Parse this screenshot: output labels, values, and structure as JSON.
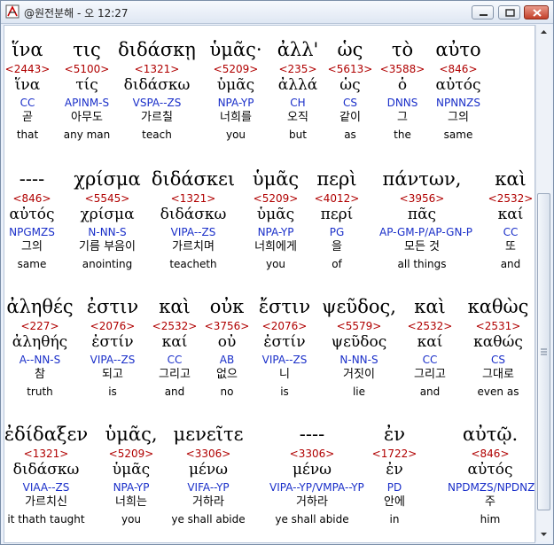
{
  "window": {
    "title": "@원전분해 - 오 12:27",
    "buttons": {
      "minimize": "minimize",
      "maximize": "maximize",
      "close": "close"
    },
    "icon": "app-bible-icon"
  },
  "colors": {
    "strong": "#b00000",
    "parse": "#1a2fc9"
  },
  "rows": [
    {
      "words": [
        {
          "greek": "ἵνα",
          "strong": "<2443>",
          "lemma": "ἵνα",
          "parse": "CC",
          "korean": "곧",
          "english": "that"
        },
        {
          "greek": "τις",
          "strong": "<5100>",
          "lemma": "τίς",
          "parse": "APINM-S",
          "korean": "아무도",
          "english": "any man"
        },
        {
          "greek": "διδάσκῃ",
          "strong": "<1321>",
          "lemma": "διδάσκω",
          "parse": "VSPA--ZS",
          "korean": "가르칠",
          "english": "teach"
        },
        {
          "greek": "ὑμᾶς·",
          "strong": "<5209>",
          "lemma": "ὑμᾶς",
          "parse": "NPA-YP",
          "korean": "너희를",
          "english": "you"
        },
        {
          "greek": "ἀλλ'",
          "strong": "<235>",
          "lemma": "ἀλλά",
          "parse": "CH",
          "korean": "오직",
          "english": "but"
        },
        {
          "greek": "ὡς",
          "strong": "<5613>",
          "lemma": "ὡς",
          "parse": "CS",
          "korean": "같이",
          "english": "as"
        },
        {
          "greek": "τὸ",
          "strong": "<3588>",
          "lemma": "ὁ",
          "parse": "DNNS",
          "korean": "그",
          "english": "the"
        },
        {
          "greek": "αὐτο",
          "strong": "<846>",
          "lemma": "αὐτός",
          "parse": "NPNNZS",
          "korean": "그의",
          "english": "same"
        }
      ]
    },
    {
      "words": [
        {
          "greek": "----",
          "strong": "<846>",
          "lemma": "αὐτός",
          "parse": "NPGMZS",
          "korean": "그의",
          "english": "same"
        },
        {
          "greek": "χρίσμα",
          "strong": "<5545>",
          "lemma": "χρίσμα",
          "parse": "N-NN-S",
          "korean": "기름 부음이",
          "english": "anointing"
        },
        {
          "greek": "διδάσκει",
          "strong": "<1321>",
          "lemma": "διδάσκω",
          "parse": "VIPA--ZS",
          "korean": "가르치며",
          "english": "teacheth"
        },
        {
          "greek": "ὑμᾶς",
          "strong": "<5209>",
          "lemma": "ὑμᾶς",
          "parse": "NPA-YP",
          "korean": "너희에게",
          "english": "you"
        },
        {
          "greek": "περὶ",
          "strong": "<4012>",
          "lemma": "περί",
          "parse": "PG",
          "korean": "을",
          "english": "of"
        },
        {
          "greek": "πάντων,",
          "strong": "<3956>",
          "lemma": "πᾶς",
          "parse": "AP-GM-P/AP-GN-P",
          "korean": "모든 것",
          "english": "all things"
        },
        {
          "greek": "καὶ",
          "strong": "<2532>",
          "lemma": "καί",
          "parse": "CC",
          "korean": "또",
          "english": "and"
        }
      ]
    },
    {
      "words": [
        {
          "greek": "ἀληθές",
          "strong": "<227>",
          "lemma": "ἀληθής",
          "parse": "A--NN-S",
          "korean": "참",
          "english": "truth"
        },
        {
          "greek": "ἐστιν",
          "strong": "<2076>",
          "lemma": "ἐστίν",
          "parse": "VIPA--ZS",
          "korean": "되고",
          "english": "is"
        },
        {
          "greek": "καὶ",
          "strong": "<2532>",
          "lemma": "καί",
          "parse": "CC",
          "korean": "그리고",
          "english": "and"
        },
        {
          "greek": "οὐκ",
          "strong": "<3756>",
          "lemma": "οὐ",
          "parse": "AB",
          "korean": "없으",
          "english": "no"
        },
        {
          "greek": "ἔστιν",
          "strong": "<2076>",
          "lemma": "ἐστίν",
          "parse": "VIPA--ZS",
          "korean": "니",
          "english": "is"
        },
        {
          "greek": "ψεῦδος,",
          "strong": "<5579>",
          "lemma": "ψεῦδος",
          "parse": "N-NN-S",
          "korean": "거짓이",
          "english": "lie"
        },
        {
          "greek": "καὶ",
          "strong": "<2532>",
          "lemma": "καί",
          "parse": "CC",
          "korean": "그리고",
          "english": "and"
        },
        {
          "greek": "καθὼς",
          "strong": "<2531>",
          "lemma": "καθώς",
          "parse": "CS",
          "korean": "그대로",
          "english": "even as"
        }
      ]
    },
    {
      "words": [
        {
          "greek": "ἐδίδαξεν",
          "strong": "<1321>",
          "lemma": "διδάσκω",
          "parse": "VIAA--ZS",
          "korean": "가르치신",
          "english": "it thath taught"
        },
        {
          "greek": "ὑμᾶς,",
          "strong": "<5209>",
          "lemma": "ὑμᾶς",
          "parse": "NPA-YP",
          "korean": "너희는",
          "english": "you"
        },
        {
          "greek": "μενεῖτε",
          "strong": "<3306>",
          "lemma": "μένω",
          "parse": "VIFA--YP",
          "korean": "거하라",
          "english": "ye shall abide"
        },
        {
          "greek": "----",
          "strong": "<3306>",
          "lemma": "μένω",
          "parse": "VIPA--YP/VMPA--YP",
          "korean": "거하라",
          "english": "ye shall abide"
        },
        {
          "greek": "ἐν",
          "strong": "<1722>",
          "lemma": "ἐν",
          "parse": "PD",
          "korean": "안에",
          "english": "in"
        },
        {
          "greek": "αὐτῷ.",
          "strong": "<846>",
          "lemma": "αὐτός",
          "parse": "NPDMZS/NPDNZS",
          "korean": "주",
          "english": "him"
        }
      ]
    }
  ]
}
